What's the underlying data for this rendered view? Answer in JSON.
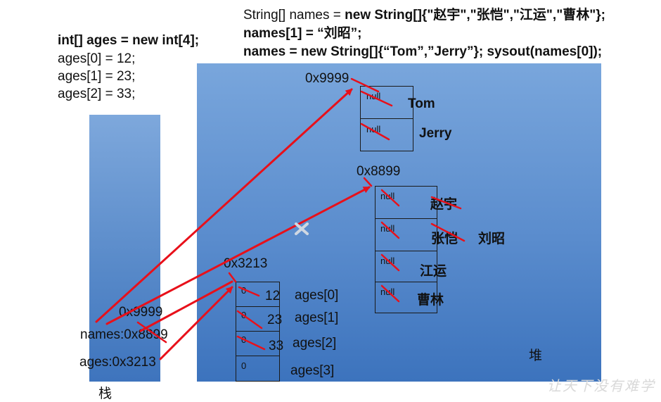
{
  "code": {
    "ages_decl": "int[] ages = new int[4];",
    "ages_assign": [
      "ages[0] = 12;",
      "ages[1] = 23;",
      "ages[2] = 33;"
    ],
    "names_line1_plain": "String[] names = ",
    "names_line1_bold": "new String[]{\"赵宇\",\"张恺\",\"江运\",\"曹林\"};",
    "names_line2": "names[1] = “刘昭”;",
    "names_line3": "names = new String[]{“Tom”,”Jerry”}; sysout(names[0]);"
  },
  "stack": {
    "label": "栈",
    "names_ref_old": "names:0x8899",
    "names_ref_new": "0x9999",
    "ages_ref": "ages:0x3213"
  },
  "heap": {
    "label": "堆",
    "array_tom_jerry": {
      "address": "0x9999",
      "cells": [
        {
          "initial": "null",
          "value": "Tom"
        },
        {
          "initial": "null",
          "value": "Jerry"
        }
      ]
    },
    "array_names": {
      "address": "0x8899",
      "cells": [
        {
          "initial": "null",
          "value": "赵宇"
        },
        {
          "initial": "null",
          "value": "张恺",
          "replaced_by": "刘昭"
        },
        {
          "initial": "null",
          "value": "江运"
        },
        {
          "initial": "null",
          "value": "曹林"
        }
      ]
    },
    "array_ages": {
      "address": "0x3213",
      "cells": [
        {
          "initial": "0",
          "value": "12",
          "index_label": "ages[0]"
        },
        {
          "initial": "0",
          "value": "23",
          "index_label": "ages[1]"
        },
        {
          "initial": "0",
          "value": "33",
          "index_label": "ages[2]"
        },
        {
          "initial": "0",
          "value": "",
          "index_label": "ages[3]"
        }
      ]
    }
  },
  "watermark": "让天下没有难学",
  "colors": {
    "arrow": "#e8101a",
    "stack_fill": "#5a8bcb",
    "heap_fill": "#5a8ccd",
    "broken_mark": "#c9d3df"
  }
}
